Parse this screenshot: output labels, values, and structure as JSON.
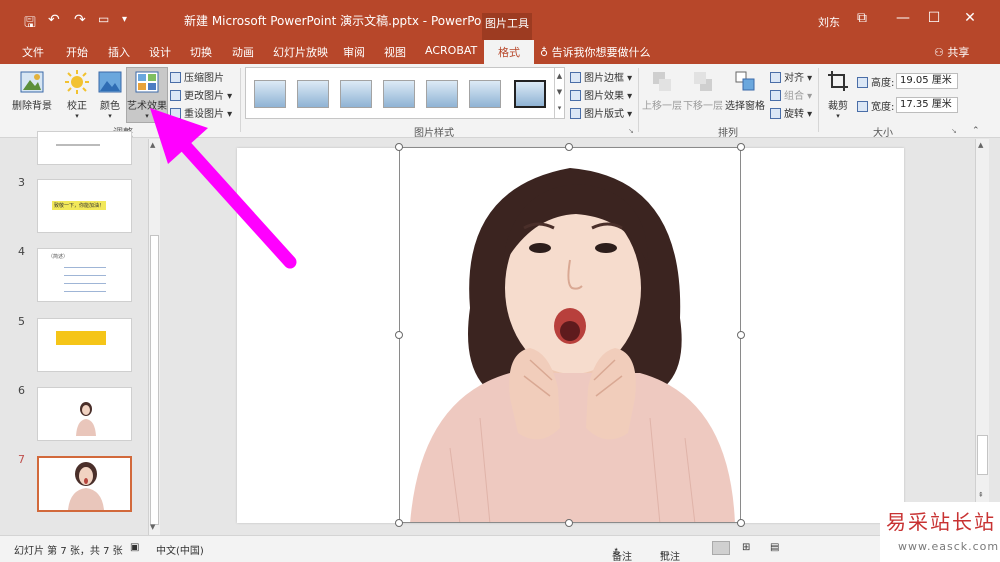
{
  "titlebar": {
    "doc_title": "新建 Microsoft PowerPoint 演示文稿.pptx  -  PowerPoint",
    "tools_tab": "图片工具",
    "user": "刘东",
    "qa_save": "🖫",
    "qa_undo": "↶",
    "qa_redo": "↷",
    "qa_custom": "▾",
    "restore": "⧉",
    "minimize": "—",
    "maximize": "☐",
    "close": "✕"
  },
  "tabs": {
    "file": "文件",
    "home": "开始",
    "insert": "插入",
    "design": "设计",
    "transitions": "切换",
    "animations": "动画",
    "slideshow": "幻灯片放映",
    "review": "审阅",
    "view": "视图",
    "acrobat": "ACROBAT",
    "format": "格式",
    "tell_me": "告诉我你想要做什么",
    "share": "共享"
  },
  "ribbon": {
    "adjust": {
      "remove_bg": "删除背景",
      "corrections": "校正",
      "color": "颜色",
      "artistic": "艺术效果",
      "compress": "压缩图片",
      "change": "更改图片",
      "reset": "重设图片",
      "group_label": "调整"
    },
    "styles": {
      "border": "图片边框",
      "effects": "图片效果",
      "layout": "图片版式",
      "group_label": "图片样式"
    },
    "arrange": {
      "bring_forward": "上移一层",
      "send_backward": "下移一层",
      "selection_pane": "选择窗格",
      "align": "对齐",
      "group": "组合",
      "rotate": "旋转",
      "group_label": "排列"
    },
    "size": {
      "crop": "裁剪",
      "height_label": "高度:",
      "height_value": "19.05 厘米",
      "width_label": "宽度:",
      "width_value": "17.35 厘米",
      "group_label": "大小"
    }
  },
  "slides": [
    {
      "number": "",
      "caption": ""
    },
    {
      "number": "3",
      "caption": "致敬一下，你能加油！"
    },
    {
      "number": "4",
      "caption": "（简述）"
    },
    {
      "number": "5",
      "caption": ""
    },
    {
      "number": "6",
      "caption": ""
    },
    {
      "number": "7",
      "caption": ""
    }
  ],
  "status": {
    "slide_info": "幻灯片 第 7 张，共 7 张",
    "language": "中文(中国)",
    "notes": "备注",
    "comments": "批注"
  },
  "watermark": {
    "site_name": "易采站长站",
    "site_url": "www.easck.com"
  },
  "colors": {
    "accent": "#b7472a",
    "arrow": "#ff00ff"
  }
}
